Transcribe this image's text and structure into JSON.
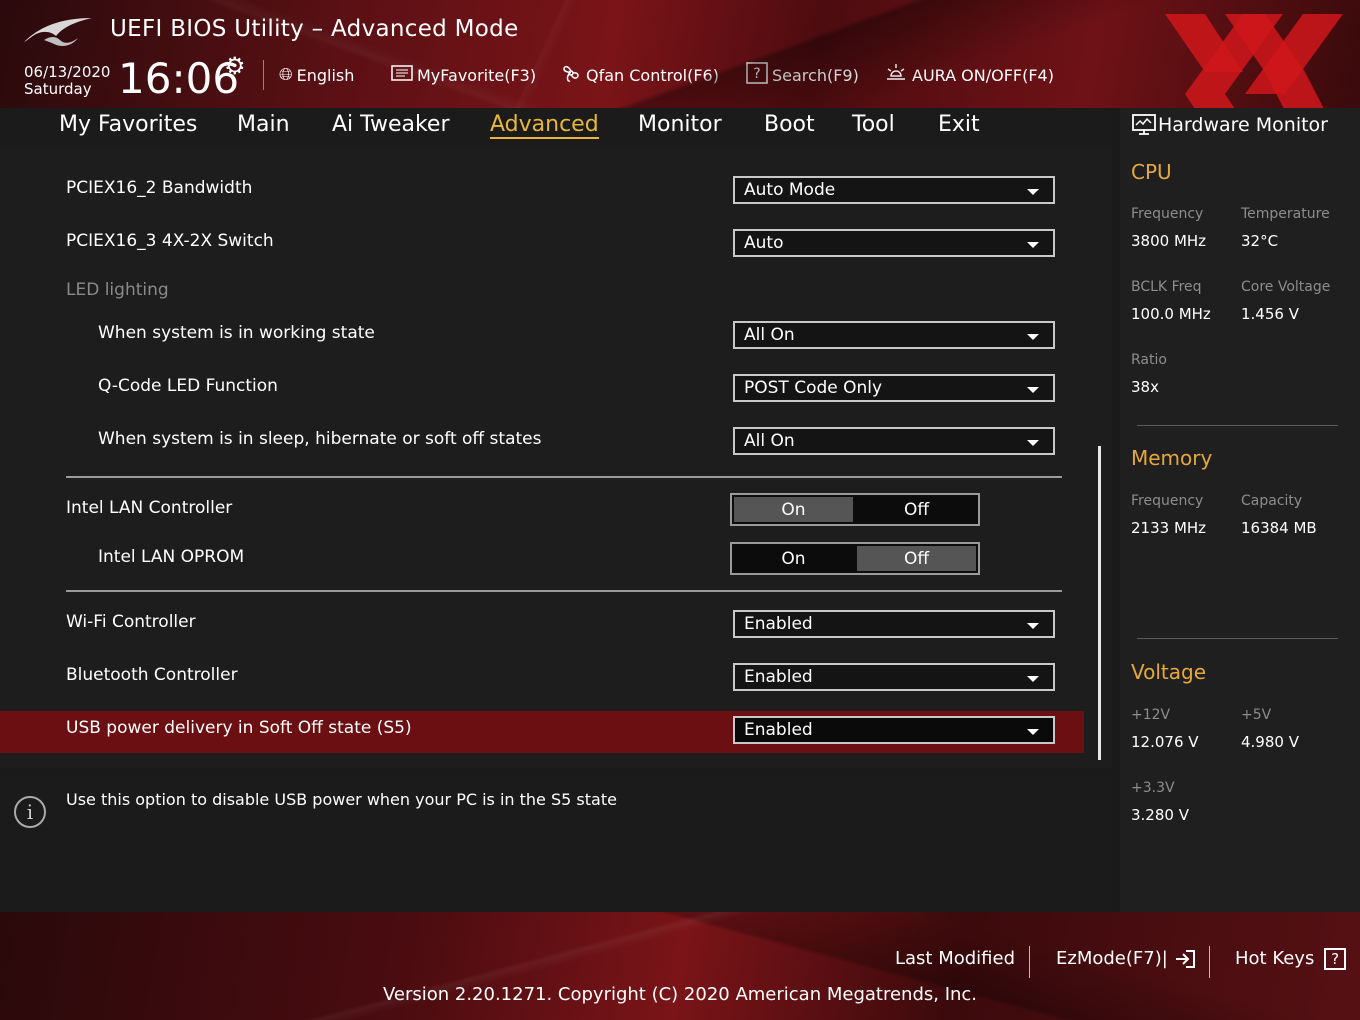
{
  "header": {
    "title": "UEFI BIOS Utility – Advanced Mode",
    "date": "06/13/2020",
    "day": "Saturday",
    "time": "16:06",
    "toolbar": [
      {
        "icon": "globe-icon",
        "label": "English"
      },
      {
        "icon": "favorite-icon",
        "label": "MyFavorite(F3)"
      },
      {
        "icon": "fan-icon",
        "label": "Qfan Control(F6)"
      },
      {
        "icon": "search-icon",
        "label": "Search(F9)"
      },
      {
        "icon": "aura-icon",
        "label": "AURA ON/OFF(F4)"
      }
    ]
  },
  "menu": {
    "items": [
      "My Favorites",
      "Main",
      "Ai Tweaker",
      "Advanced",
      "Monitor",
      "Boot",
      "Tool",
      "Exit"
    ],
    "active": "Advanced"
  },
  "settings": {
    "pciex16_2": {
      "label": "PCIEX16_2 Bandwidth",
      "value": "Auto Mode"
    },
    "pciex16_3": {
      "label": "PCIEX16_3 4X-2X Switch",
      "value": "Auto"
    },
    "led_heading": "LED lighting",
    "led_working": {
      "label": "When system is in working state",
      "value": "All On"
    },
    "qcode": {
      "label": "Q-Code LED Function",
      "value": "POST Code Only"
    },
    "led_sleep": {
      "label": "When system is in sleep, hibernate or soft off states",
      "value": "All On"
    },
    "lan_ctrl": {
      "label": "Intel LAN Controller",
      "on": "On",
      "off": "Off",
      "selected": "On"
    },
    "lan_oprom": {
      "label": "Intel LAN OPROM",
      "on": "On",
      "off": "Off",
      "selected": "Off"
    },
    "wifi": {
      "label": "Wi-Fi Controller",
      "value": "Enabled"
    },
    "bluetooth": {
      "label": "Bluetooth Controller",
      "value": "Enabled"
    },
    "usb_s5": {
      "label": "USB power delivery in Soft Off state (S5)",
      "value": "Enabled"
    }
  },
  "info": {
    "text": "Use this option to disable USB power when your PC is in the S5 state"
  },
  "hw_monitor": {
    "title": "Hardware Monitor",
    "cpu": {
      "heading": "CPU",
      "frequency_label": "Frequency",
      "frequency": "3800 MHz",
      "temperature_label": "Temperature",
      "temperature": "32°C",
      "bclk_label": "BCLK Freq",
      "bclk": "100.0 MHz",
      "core_voltage_label": "Core Voltage",
      "core_voltage": "1.456 V",
      "ratio_label": "Ratio",
      "ratio": "38x"
    },
    "memory": {
      "heading": "Memory",
      "frequency_label": "Frequency",
      "frequency": "2133 MHz",
      "capacity_label": "Capacity",
      "capacity": "16384 MB"
    },
    "voltage": {
      "heading": "Voltage",
      "v12_label": "+12V",
      "v12": "12.076 V",
      "v5_label": "+5V",
      "v5": "4.980 V",
      "v33_label": "+3.3V",
      "v33": "3.280 V"
    }
  },
  "footer": {
    "last_modified": "Last Modified",
    "ezmode": "EzMode(F7)|",
    "hotkeys": "Hot Keys",
    "hotkeys_glyph": "?",
    "version": "Version 2.20.1271. Copyright (C) 2020 American Megatrends, Inc."
  },
  "colors": {
    "accent": "#e7b73a",
    "section_heading": "#e7a83a",
    "selected_row": "#6b0f12",
    "brand_red": "#7a1418"
  }
}
